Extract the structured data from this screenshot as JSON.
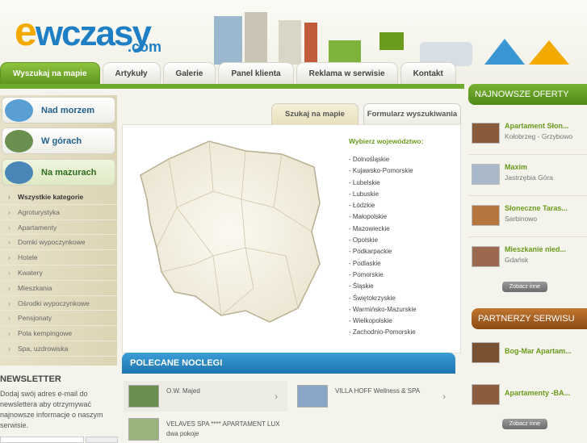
{
  "logo": {
    "main": "wczasy",
    "e": "e",
    "domain": ".com"
  },
  "nav": {
    "tabs": [
      "Wyszukaj na mapie",
      "Artykuły",
      "Galerie",
      "Panel klienta",
      "Reklama w serwisie",
      "Kontakt"
    ]
  },
  "categories": {
    "buttons": [
      "Nad morzem",
      "W górach",
      "Na mazurach"
    ],
    "list": [
      "Wszystkie kategorie",
      "Agroturystyka",
      "Apartamenty",
      "Domki wypoczynkowe",
      "Hotele",
      "Kwatery",
      "Mieszkania",
      "Ośrodki wypoczynkowe",
      "Pensjonaty",
      "Pola kempingowe",
      "Spa, uzdrowiska"
    ]
  },
  "newsletter": {
    "title": "NEWSLETTER",
    "text": "Dodaj swój adres e-mail do newslettera aby otrzymywać najnowsze informacje o naszym serwisie."
  },
  "search": {
    "tabs": [
      "Szukaj na mapie",
      "Formularz wyszukiwania"
    ],
    "voi_title": "Wybierz województwo:",
    "voivodeships": [
      "- Dolnośląskie",
      "- Kujawsko-Pomorskie",
      "- Lubelskie",
      "- Lubuskie",
      "- Łódzkie",
      "- Małopolskie",
      "- Mazowieckie",
      "- Opolskie",
      "- Podkarpackie",
      "- Podlaskie",
      "- Pomorskie",
      "- Śląskie",
      "- Świętokrzyskie",
      "- Warmińsko-Mazurskie",
      "- Wielkopolskie",
      "- Zachodnio-Pomorskie"
    ]
  },
  "polecane": {
    "title": "POLECANE NOCLEGI",
    "items": [
      "O.W. Majed",
      "VILLA HOFF Wellness & SPA",
      "VELAVES SPA **** APARTAMENT LUX dwa pokoje"
    ]
  },
  "right": {
    "newest_title": "NAJNOWSZE OFERTY",
    "newest": [
      {
        "name": "Apartament Słon...",
        "loc": "Kołobrzeg - Grzybowo"
      },
      {
        "name": "Maxim",
        "loc": "Jastrzębia Góra"
      },
      {
        "name": "Słoneczne Taras...",
        "loc": "Sarbinowo"
      },
      {
        "name": "Mieszkanie nied...",
        "loc": "Gdańsk"
      }
    ],
    "more": "Zobacz inne",
    "partners_title": "PARTNERZY SERWISU",
    "partners": [
      "Bog-Mar Apartam...",
      "Apartamenty -BA..."
    ]
  },
  "colors": {
    "green": "#6ea82c",
    "blue": "#1f7fc4",
    "orange": "#f2a900"
  }
}
